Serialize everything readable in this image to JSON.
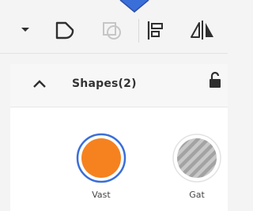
{
  "toolbar": {
    "tools": [
      {
        "icon": "chevron-down-icon"
      },
      {
        "icon": "shape-path-icon"
      },
      {
        "icon": "shape-combine-icon",
        "disabled": true
      },
      {
        "icon": "align-left-icon"
      },
      {
        "icon": "flip-horizontal-icon"
      }
    ]
  },
  "panel": {
    "title": "Shapes(2)",
    "locked": false,
    "expanded": true
  },
  "shapes": [
    {
      "name": "Vast",
      "fill": "#f5821f",
      "selected": true,
      "pattern": "solid"
    },
    {
      "name": "Gat",
      "fill": "#b5b5b5",
      "selected": false,
      "pattern": "striped"
    }
  ],
  "colors": {
    "accent": "#3a6ed8",
    "icon": "#2f2f2f",
    "disabled_icon": "#bcbcbc"
  }
}
